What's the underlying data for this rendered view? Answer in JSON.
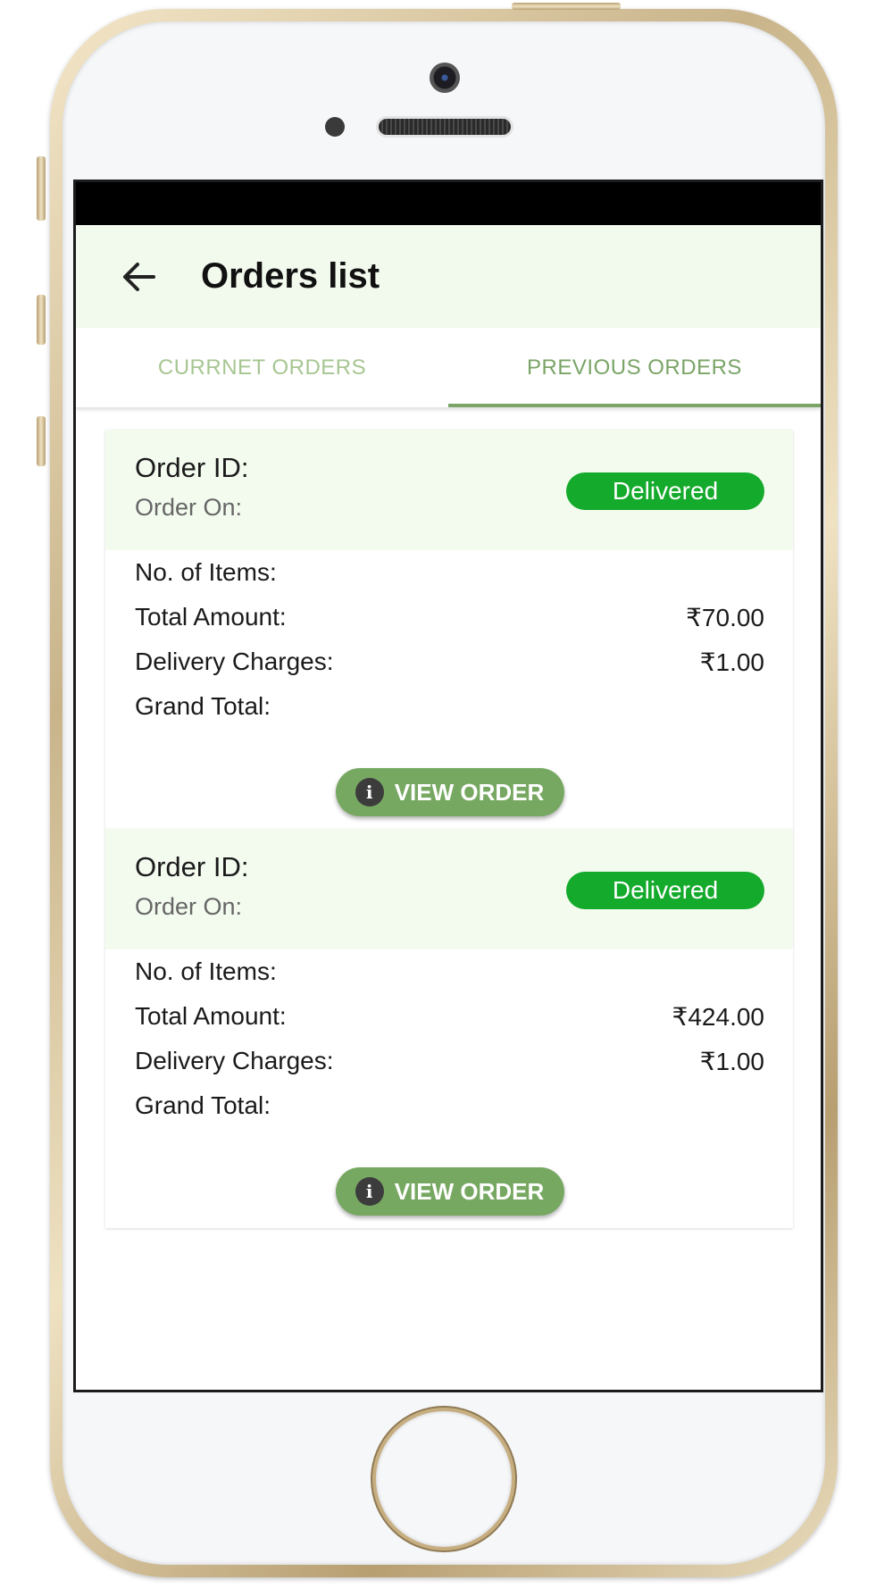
{
  "header": {
    "title": "Orders list"
  },
  "tabs": [
    {
      "label": "CURRNET ORDERS",
      "active": false
    },
    {
      "label": "PREVIOUS ORDERS",
      "active": true
    }
  ],
  "orders": [
    {
      "order_id_label": "Order ID:",
      "order_on_label": "Order On:",
      "status": "Delivered",
      "items_label": "No. of Items:",
      "items_value": "",
      "total_label": "Total Amount:",
      "total_value": "₹70.00",
      "delivery_label": "Delivery Charges:",
      "delivery_value": "₹1.00",
      "grand_label": "Grand Total:",
      "grand_value": "",
      "button_label": "VIEW ORDER"
    },
    {
      "order_id_label": "Order ID:",
      "order_on_label": "Order On:",
      "status": "Delivered",
      "items_label": "No. of Items:",
      "items_value": "",
      "total_label": "Total Amount:",
      "total_value": "₹424.00",
      "delivery_label": "Delivery Charges:",
      "delivery_value": "₹1.00",
      "grand_label": "Grand Total:",
      "grand_value": "",
      "button_label": "VIEW ORDER"
    }
  ],
  "icons": {
    "back": "arrow-left-icon",
    "info": "info-icon"
  },
  "colors": {
    "accent": "#7aa567",
    "status": "#14aa2b",
    "header_bg": "#f2faee"
  }
}
